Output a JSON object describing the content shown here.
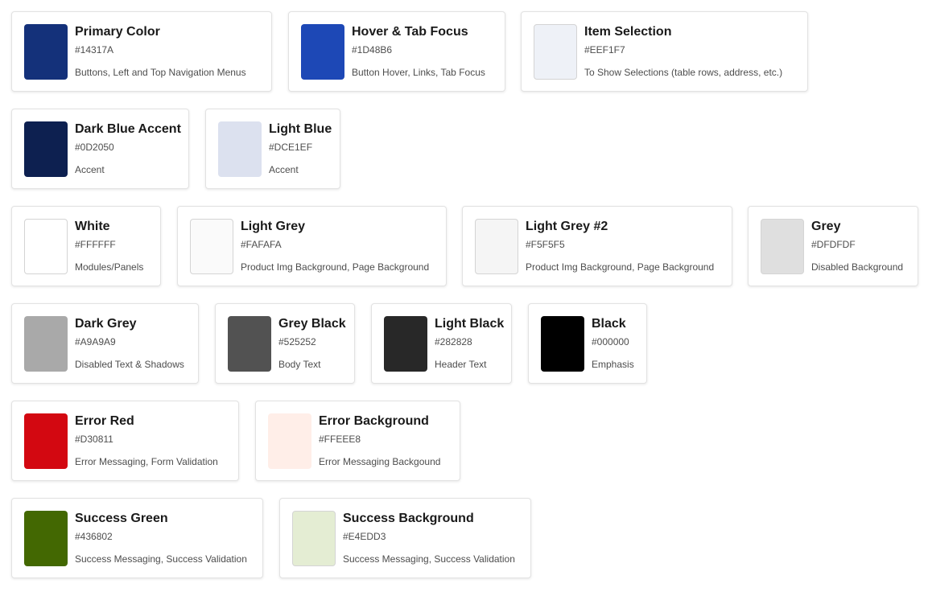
{
  "colors": [
    {
      "name": "Primary Color",
      "hex": "#14317A",
      "usage": "Buttons, Left and Top Navigation Menus",
      "swatch": "#14317A"
    },
    {
      "name": "Hover & Tab Focus",
      "hex": "#1D48B6",
      "usage": "Button Hover, Links, Tab Focus",
      "swatch": "#1D48B6"
    },
    {
      "name": "Item Selection",
      "hex": "#EEF1F7",
      "usage": "To Show Selections (table rows, address, etc.)",
      "swatch": "#EEF1F7"
    },
    {
      "name": "Dark Blue Accent",
      "hex": "#0D2050",
      "usage": "Accent",
      "swatch": "#0D2050"
    },
    {
      "name": "Light Blue",
      "hex": "#DCE1EF",
      "usage": "Accent",
      "swatch": "#DCE1EF"
    },
    {
      "name": "White",
      "hex": "#FFFFFF",
      "usage": "Modules/Panels",
      "swatch": "#FFFFFF"
    },
    {
      "name": "Light Grey",
      "hex": "#FAFAFA",
      "usage": "Product Img Background, Page Background",
      "swatch": "#FAFAFA"
    },
    {
      "name": "Light Grey #2",
      "hex": "#F5F5F5",
      "usage": "Product Img Background, Page Background",
      "swatch": "#F5F5F5"
    },
    {
      "name": "Grey",
      "hex": "#DFDFDF",
      "usage": "Disabled Background",
      "swatch": "#DFDFDF"
    },
    {
      "name": "Dark Grey",
      "hex": "#A9A9A9",
      "usage": "Disabled Text & Shadows",
      "swatch": "#A9A9A9"
    },
    {
      "name": "Grey Black",
      "hex": "#525252",
      "usage": "Body Text",
      "swatch": "#525252"
    },
    {
      "name": "Light Black",
      "hex": "#282828",
      "usage": "Header Text",
      "swatch": "#282828"
    },
    {
      "name": "Black",
      "hex": "#000000",
      "usage": "Emphasis",
      "swatch": "#000000"
    },
    {
      "name": "Error Red",
      "hex": "#D30811",
      "usage": "Error Messaging, Form Validation",
      "swatch": "#D30811"
    },
    {
      "name": "Error Background",
      "hex": "#FFEEE8",
      "usage": "Error Messaging Backgound",
      "swatch": "#FFEEE8"
    },
    {
      "name": "Success Green",
      "hex": "#436802",
      "usage": "Success Messaging, Success Validation",
      "swatch": "#436802"
    },
    {
      "name": "Success Background",
      "hex": "#E4EDD3",
      "usage": "Success Messaging, Success Validation",
      "swatch": "#E4EDD3"
    }
  ]
}
